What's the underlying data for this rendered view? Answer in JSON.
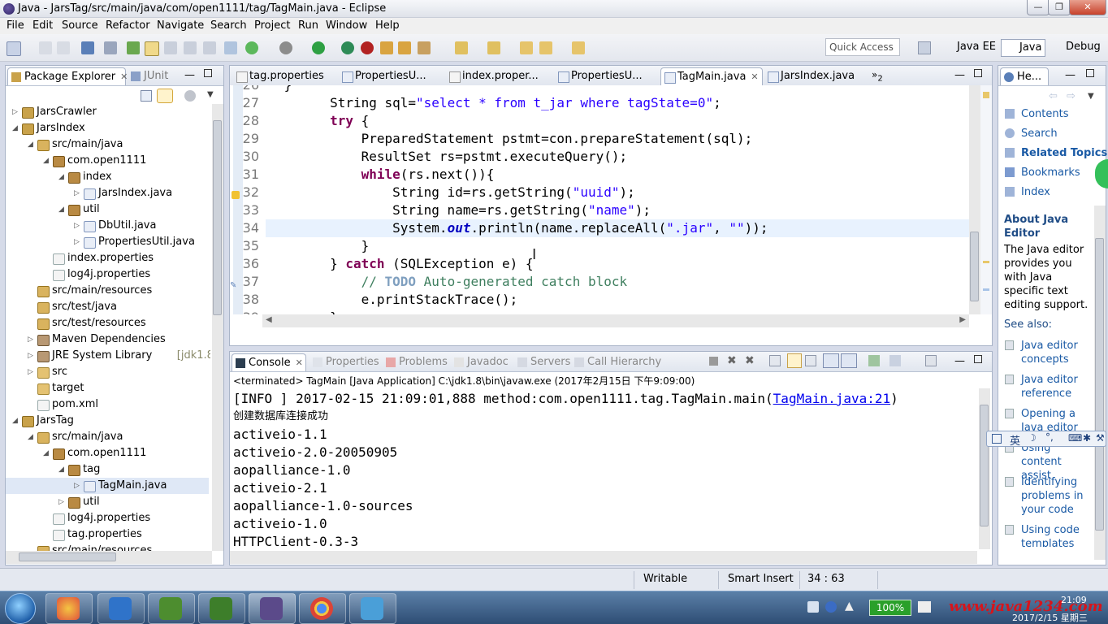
{
  "window": {
    "title": "Java - JarsTag/src/main/java/com/open1111/tag/TagMain.java - Eclipse"
  },
  "menu": [
    "File",
    "Edit",
    "Source",
    "Refactor",
    "Navigate",
    "Search",
    "Project",
    "Run",
    "Window",
    "Help"
  ],
  "toolbar": {
    "quick_access": "Quick Access",
    "perspectives": [
      "Java EE",
      "Java",
      "Debug"
    ]
  },
  "explorer": {
    "tabs": [
      "Package Explorer",
      "JUnit"
    ],
    "tree": [
      {
        "label": "JarsCrawler",
        "type": "project"
      },
      {
        "label": "JarsIndex",
        "type": "project"
      },
      {
        "label": "src/main/java",
        "type": "src"
      },
      {
        "label": "com.open1111",
        "type": "pkg"
      },
      {
        "label": "index",
        "type": "pkg"
      },
      {
        "label": "JarsIndex.java",
        "type": "java"
      },
      {
        "label": "util",
        "type": "pkg"
      },
      {
        "label": "DbUtil.java",
        "type": "java"
      },
      {
        "label": "PropertiesUtil.java",
        "type": "java"
      },
      {
        "label": "index.properties",
        "type": "file"
      },
      {
        "label": "log4j.properties",
        "type": "file"
      },
      {
        "label": "src/main/resources",
        "type": "src"
      },
      {
        "label": "src/test/java",
        "type": "src"
      },
      {
        "label": "src/test/resources",
        "type": "src"
      },
      {
        "label": "Maven Dependencies",
        "type": "lib"
      },
      {
        "label": "JRE System Library",
        "type": "lib",
        "extra": "[jdk1.8]"
      },
      {
        "label": "src",
        "type": "folder"
      },
      {
        "label": "target",
        "type": "folder"
      },
      {
        "label": "pom.xml",
        "type": "file"
      },
      {
        "label": "JarsTag",
        "type": "project"
      },
      {
        "label": "src/main/java",
        "type": "src"
      },
      {
        "label": "com.open1111",
        "type": "pkg"
      },
      {
        "label": "tag",
        "type": "pkg"
      },
      {
        "label": "TagMain.java",
        "type": "java"
      },
      {
        "label": "util",
        "type": "pkg"
      },
      {
        "label": "log4j.properties",
        "type": "file"
      },
      {
        "label": "tag.properties",
        "type": "file"
      },
      {
        "label": "src/main/resources",
        "type": "src"
      }
    ]
  },
  "editor": {
    "tabs": [
      "tag.properties",
      "PropertiesU...",
      "index.proper...",
      "PropertiesU...",
      "TagMain.java",
      "JarsIndex.java"
    ],
    "overflow_count": "2",
    "first_line_no": "26",
    "lines": [
      {
        "no": "27",
        "parts": [
          [
            "plain",
            "        String sql="
          ],
          [
            "str",
            "\"select * from t_jar where tagState=0\""
          ],
          [
            "plain",
            ";"
          ]
        ]
      },
      {
        "no": "28",
        "parts": [
          [
            "kw",
            "        try"
          ],
          [
            "plain",
            " {"
          ]
        ]
      },
      {
        "no": "29",
        "parts": [
          [
            "plain",
            "            PreparedStatement pstmt=con.prepareStatement(sql);"
          ]
        ]
      },
      {
        "no": "30",
        "parts": [
          [
            "plain",
            "            ResultSet rs=pstmt.executeQuery();"
          ]
        ]
      },
      {
        "no": "31",
        "parts": [
          [
            "kw",
            "            while"
          ],
          [
            "plain",
            "(rs.next()){"
          ]
        ]
      },
      {
        "no": "32",
        "parts": [
          [
            "plain",
            "                String id=rs.getString("
          ],
          [
            "str",
            "\"uuid\""
          ],
          [
            "plain",
            ");"
          ]
        ]
      },
      {
        "no": "33",
        "parts": [
          [
            "plain",
            "                String name=rs.getString("
          ],
          [
            "str",
            "\"name\""
          ],
          [
            "plain",
            ");"
          ]
        ]
      },
      {
        "no": "34",
        "parts": [
          [
            "plain",
            "                System."
          ],
          [
            "fld",
            "out"
          ],
          [
            "plain",
            ".println(name.replaceAll("
          ],
          [
            "str",
            "\".jar\""
          ],
          [
            "plain",
            ", "
          ],
          [
            "str",
            "\"\""
          ],
          [
            "plain",
            "));"
          ]
        ]
      },
      {
        "no": "35",
        "parts": [
          [
            "plain",
            "            }"
          ]
        ]
      },
      {
        "no": "36",
        "parts": [
          [
            "plain",
            "        } "
          ],
          [
            "kw",
            "catch"
          ],
          [
            "plain",
            " (SQLException e) {"
          ]
        ]
      },
      {
        "no": "37",
        "parts": [
          [
            "com",
            "            // "
          ],
          [
            "todo",
            "TODO"
          ],
          [
            "com",
            " Auto-generated catch block"
          ]
        ]
      },
      {
        "no": "38",
        "parts": [
          [
            "plain",
            "            e.printStackTrace();"
          ]
        ]
      },
      {
        "no": "39",
        "parts": [
          [
            "plain",
            "        }"
          ]
        ]
      }
    ]
  },
  "console": {
    "tabs": [
      "Console",
      "Properties",
      "Problems",
      "Javadoc",
      "Servers",
      "Call Hierarchy"
    ],
    "status": "<terminated> TagMain [Java Application] C:\\jdk1.8\\bin\\javaw.exe (2017年2月15日 下午9:09:00)",
    "info_prefix": "[INFO ] 2017-02-15 21:09:01,888 method:com.open1111.tag.TagMain.main(",
    "info_link": "TagMain.java:21",
    "info_suffix": ")",
    "lines": [
      "创建数据库连接成功",
      "activeio-1.1",
      "activeio-2.0-20050905",
      "aopalliance-1.0",
      "activeio-2.1",
      "aopalliance-1.0-sources",
      "activeio-1.0",
      "HTTPClient-0.3-3"
    ]
  },
  "help": {
    "tab": "He...",
    "items": [
      "Contents",
      "Search",
      "Related Topics",
      "Bookmarks",
      "Index"
    ],
    "about_title": "About Java Editor",
    "about_text": "The Java editor provides you with Java specific text editing support.",
    "see_also": "See also:",
    "links": [
      "Java editor concepts",
      "Java editor reference",
      "Opening a Java editor",
      "Using content assist",
      "Identifying problems in your code",
      "Using code templates"
    ]
  },
  "statusbar": {
    "writable": "Writable",
    "insert_mode": "Smart Insert",
    "position": "34 : 63"
  },
  "taskbar": {
    "battery": "100%",
    "watermark": "www.java1234.com",
    "date": "2017/2/15 星期三",
    "time": "21:09",
    "ime": "英"
  }
}
